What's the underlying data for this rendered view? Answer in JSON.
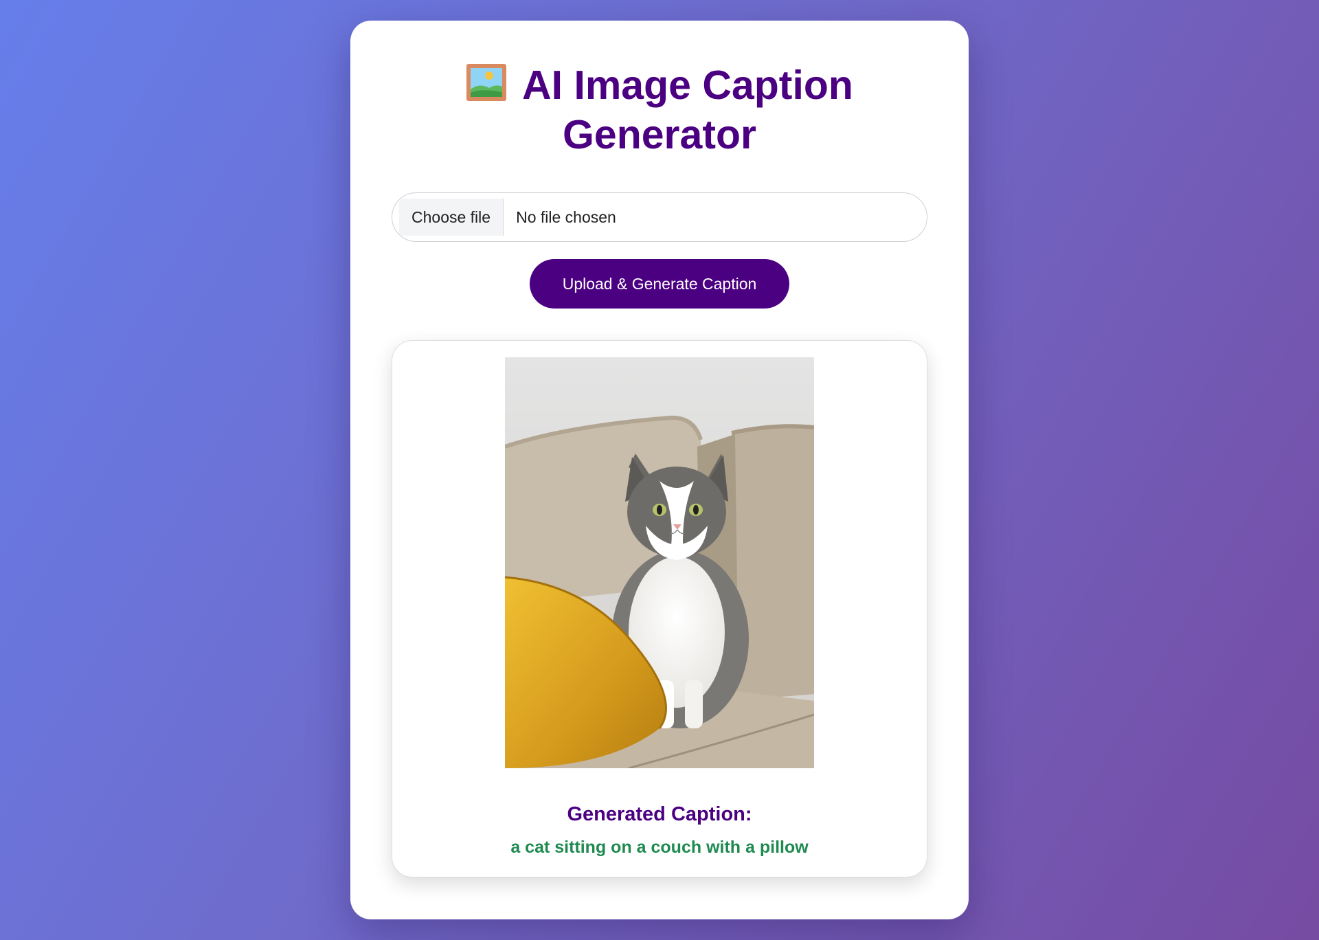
{
  "header": {
    "icon": "framed-picture-icon",
    "title": "AI Image Caption Generator"
  },
  "upload": {
    "choose_label": "Choose file",
    "file_status": "No file chosen",
    "submit_label": "Upload & Generate Caption"
  },
  "result": {
    "image_subject": "cat-photo",
    "caption_heading": "Generated Caption:",
    "caption": "a cat sitting on a couch with a pillow"
  },
  "colors": {
    "accent": "#4b0082",
    "caption": "#1e8a50",
    "background_start": "#667eea",
    "background_end": "#764ba2"
  }
}
